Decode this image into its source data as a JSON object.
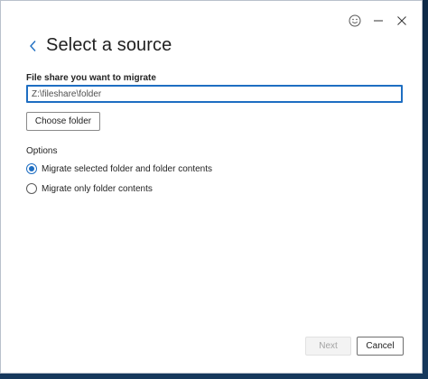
{
  "window": {
    "controls": [
      {
        "name": "feedback-smiley",
        "icon": "smiley-icon"
      },
      {
        "name": "minimize",
        "icon": "minimize-icon"
      },
      {
        "name": "close",
        "icon": "close-icon"
      }
    ]
  },
  "header": {
    "back_icon": "chevron-left-icon",
    "title": "Select a source"
  },
  "file_share": {
    "label": "File share you want to migrate",
    "value": "Z:\\fileshare\\folder"
  },
  "choose_folder_label": "Choose folder",
  "options": {
    "label": "Options",
    "items": [
      {
        "label": "Migrate selected folder and folder contents",
        "checked": true
      },
      {
        "label": "Migrate only folder contents",
        "checked": false
      }
    ]
  },
  "footer": {
    "next_label": "Next",
    "next_enabled": false,
    "cancel_label": "Cancel"
  },
  "colors": {
    "accent": "#1e6ec2",
    "text": "#242424",
    "disabled_text": "#a3a3a3"
  }
}
